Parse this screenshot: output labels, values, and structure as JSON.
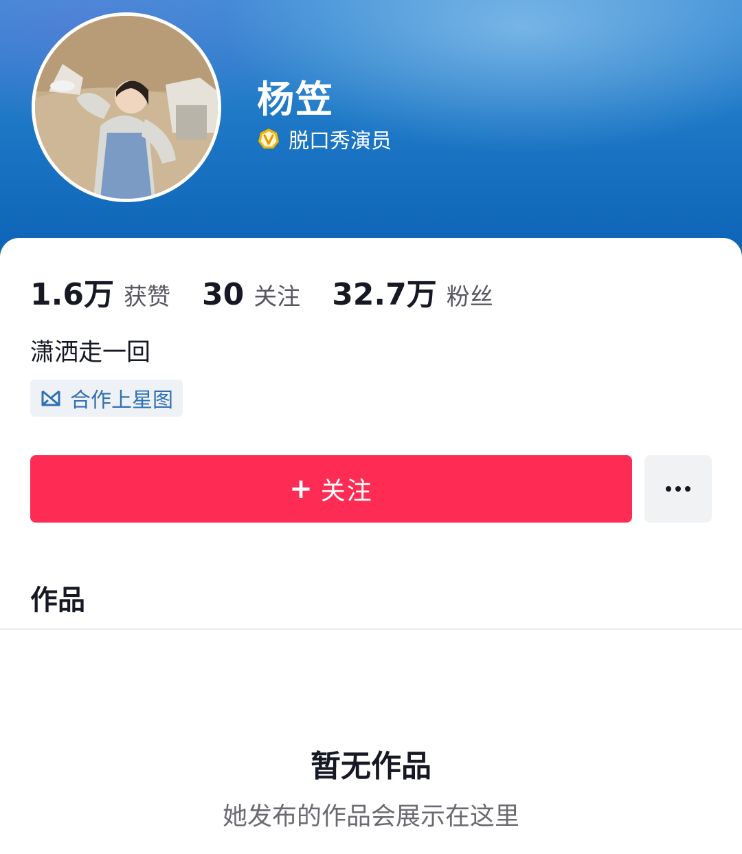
{
  "profile": {
    "name": "杨笠",
    "verification_label": "脱口秀演员",
    "bio": "潇洒走一回",
    "tag_label": "合作上星图"
  },
  "stats": [
    {
      "value": "1.6万",
      "label": "获赞"
    },
    {
      "value": "30",
      "label": "关注"
    },
    {
      "value": "32.7万",
      "label": "粉丝"
    }
  ],
  "actions": {
    "follow_plus": "+",
    "follow_label": "关注",
    "more_icon": "more-dots-icon"
  },
  "tabs": {
    "works_label": "作品"
  },
  "empty_state": {
    "title": "暂无作品",
    "subtitle": "她发布的作品会展示在这里"
  },
  "colors": {
    "header_blue": "#1e78c6",
    "follow_button": "#fe2c55",
    "tag_text": "#2f6fb3",
    "verify_badge": "#f4b400"
  }
}
